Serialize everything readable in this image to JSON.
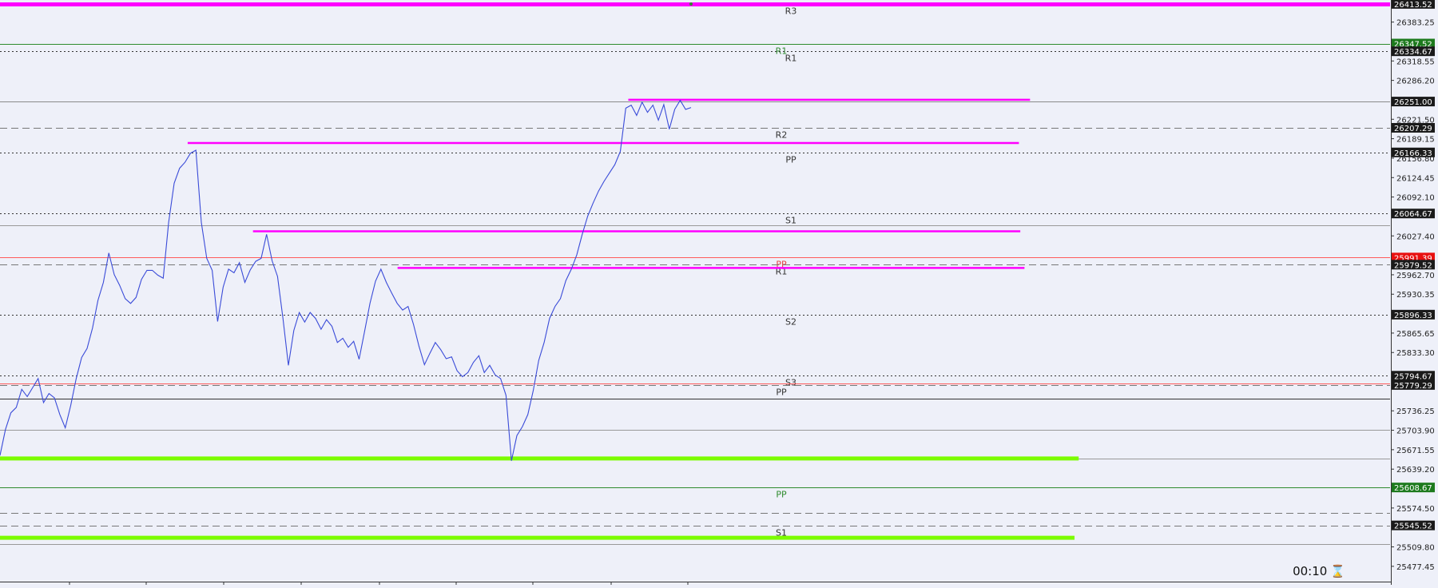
{
  "chart_data": {
    "type": "line",
    "title": "",
    "xlabel": "",
    "ylabel": "",
    "ylim": [
      25452,
      26420
    ],
    "grid": false,
    "series": [
      {
        "values": [
          25662,
          25705,
          25733,
          25742,
          25772,
          25760,
          25775,
          25790,
          25750,
          25765,
          25758,
          25730,
          25708,
          25745,
          25790,
          25825,
          25840,
          25874,
          25920,
          25950,
          25999,
          25963,
          25945,
          25923,
          25915,
          25925,
          25955,
          25970,
          25970,
          25962,
          25957,
          26050,
          26115,
          26140,
          26150,
          26165,
          26170,
          26050,
          25990,
          25970,
          25885,
          25942,
          25972,
          25966,
          25983,
          25950,
          25971,
          25985,
          25990,
          26030,
          25986,
          25960,
          25890,
          25812,
          25870,
          25900,
          25884,
          25900,
          25890,
          25872,
          25888,
          25877,
          25850,
          25857,
          25842,
          25852,
          25822,
          25868,
          25915,
          25952,
          25972,
          25950,
          25932,
          25915,
          25904,
          25910,
          25880,
          25844,
          25813,
          25832,
          25850,
          25838,
          25823,
          25826,
          25803,
          25793,
          25800,
          25817,
          25828,
          25800,
          25812,
          25796,
          25790,
          25762,
          25653,
          25695,
          25710,
          25730,
          25770,
          25820,
          25850,
          25890,
          25910,
          25923,
          25953,
          25972,
          25996,
          26030,
          26060,
          26082,
          26102,
          26118,
          26132,
          26146,
          26168,
          26240,
          26245,
          26228,
          26250,
          26233,
          26245,
          26220,
          26246,
          26205,
          26238,
          26253,
          26238,
          26241
        ]
      }
    ],
    "y_ticks": [
      "26383.25",
      "26318.55",
      "26286.20",
      "26221.50",
      "26189.15",
      "26156.80",
      "26124.45",
      "26092.10",
      "26027.40",
      "25962.70",
      "25930.35",
      "25865.65",
      "25833.30",
      "25736.25",
      "25703.90",
      "25671.55",
      "25639.20",
      "25574.50",
      "25509.80",
      "25477.45"
    ],
    "levels": [
      {
        "label": "R3",
        "y": 26413.52,
        "price_tag": "26413.52",
        "color": "#ff00ff",
        "style": "thick",
        "x_end": 1.0,
        "tag_bg": "#1a1a1a",
        "label_color": "#333333"
      },
      {
        "label": "R1",
        "y": 26347.52,
        "price_tag": "26347.52",
        "color": "#2e8b2e",
        "style": "solid",
        "x_end": 1.0,
        "tag_bg": "#1d7a1d",
        "label_color": "#2e8b2e"
      },
      {
        "label": "R1",
        "y": 26334.67,
        "price_tag": "26334.67",
        "color": "#333333",
        "style": "dotted",
        "x_end": 1.0,
        "tag_bg": "#1a1a1a",
        "label_color": "#333333"
      },
      {
        "label": "",
        "y": 26251.0,
        "price_tag": "26251.00",
        "color": "#8a8a8a",
        "style": "solid",
        "x_end": 1.0,
        "tag_bg": "#1a1a1a",
        "label_color": "#333333"
      },
      {
        "label": "R2",
        "y": 26207.29,
        "price_tag": "26207.29",
        "color": "#777777",
        "style": "dashed",
        "x_end": 1.0,
        "tag_bg": "#1a1a1a",
        "label_color": "#333333"
      },
      {
        "label": "PP",
        "y": 26166.33,
        "price_tag": "26166.33",
        "color": "#333333",
        "style": "dotted",
        "x_end": 1.0,
        "tag_bg": "#1a1a1a",
        "label_color": "#333333"
      },
      {
        "label": "S1",
        "y": 26064.67,
        "price_tag": "26064.67",
        "color": "#333333",
        "style": "dotted",
        "x_end": 1.0,
        "tag_bg": "#1a1a1a",
        "label_color": "#333333"
      },
      {
        "label": "",
        "y": 26045.0,
        "price_tag": "",
        "color": "#999999",
        "style": "solid",
        "x_end": 1.0,
        "tag_bg": "",
        "label_color": "#333333"
      },
      {
        "label": "PP",
        "y": 25991.39,
        "price_tag": "25991.39",
        "color": "#ff5a5a",
        "style": "solid",
        "x_end": 1.0,
        "tag_bg": "#e81010",
        "label_color": "#e84040"
      },
      {
        "label": "R1",
        "y": 25979.52,
        "price_tag": "25979.52",
        "color": "#777777",
        "style": "dashed",
        "x_end": 1.0,
        "tag_bg": "#1a1a1a",
        "label_color": "#333333"
      },
      {
        "label": "S2",
        "y": 25896.33,
        "price_tag": "25896.33",
        "color": "#333333",
        "style": "dotted",
        "x_end": 1.0,
        "tag_bg": "#1a1a1a",
        "label_color": "#333333"
      },
      {
        "label": "S3",
        "y": 25794.67,
        "price_tag": "25794.67",
        "color": "#333333",
        "style": "dotted",
        "x_end": 1.0,
        "tag_bg": "#1a1a1a",
        "label_color": "#333333"
      },
      {
        "label": "",
        "y": 25782.0,
        "price_tag": "",
        "color": "#ff5a5a",
        "style": "solid",
        "x_end": 1.0,
        "tag_bg": "",
        "label_color": "#333333"
      },
      {
        "label": "PP",
        "y": 25779.29,
        "price_tag": "25779.29",
        "color": "#777777",
        "style": "dashed",
        "x_end": 1.0,
        "tag_bg": "#1a1a1a",
        "label_color": "#333333"
      },
      {
        "label": "",
        "y": 25757.0,
        "price_tag": "",
        "color": "#333333",
        "style": "solid",
        "x_end": 1.0,
        "tag_bg": "",
        "label_color": "#333333"
      },
      {
        "label": "",
        "y": 25704.0,
        "price_tag": "",
        "color": "#999999",
        "style": "solid",
        "x_end": 1.0,
        "tag_bg": "",
        "label_color": "#333333"
      },
      {
        "label": "",
        "y": 25657.0,
        "price_tag": "",
        "color": "#999999",
        "style": "solid",
        "x_end": 1.0,
        "tag_bg": "",
        "label_color": "#333333"
      },
      {
        "label": "PP",
        "y": 25608.67,
        "price_tag": "25608.67",
        "color": "#2e8b2e",
        "style": "solid",
        "x_end": 1.0,
        "tag_bg": "#1d7a1d",
        "label_color": "#2e8b2e"
      },
      {
        "label": "",
        "y": 25566.0,
        "price_tag": "",
        "color": "#777777",
        "style": "dashed",
        "x_end": 1.0,
        "tag_bg": "",
        "label_color": "#333333"
      },
      {
        "label": "S1",
        "y": 25545.52,
        "price_tag": "25545.52",
        "color": "#777777",
        "style": "dashed",
        "x_end": 1.0,
        "tag_bg": "#1a1a1a",
        "label_color": "#333333"
      },
      {
        "label": "",
        "y": 25515.0,
        "price_tag": "",
        "color": "#999999",
        "style": "solid",
        "x_end": 1.0,
        "tag_bg": "",
        "label_color": "#333333"
      }
    ],
    "segments": [
      {
        "y": 26254,
        "x_start": 0.452,
        "x_end": 0.741,
        "color": "#ff00ff"
      },
      {
        "y": 26182,
        "x_start": 0.135,
        "x_end": 0.733,
        "color": "#ff00ff"
      },
      {
        "y": 26035,
        "x_start": 0.182,
        "x_end": 0.734,
        "color": "#ff00ff"
      },
      {
        "y": 25974,
        "x_start": 0.286,
        "x_end": 0.737,
        "color": "#ff00ff"
      },
      {
        "y": 25657,
        "x_start": 0.0,
        "x_end": 0.776,
        "color": "#7cfc00"
      },
      {
        "y": 25525,
        "x_start": 0.0,
        "x_end": 0.773,
        "color": "#7cfc00"
      }
    ],
    "timer": "00:10"
  }
}
